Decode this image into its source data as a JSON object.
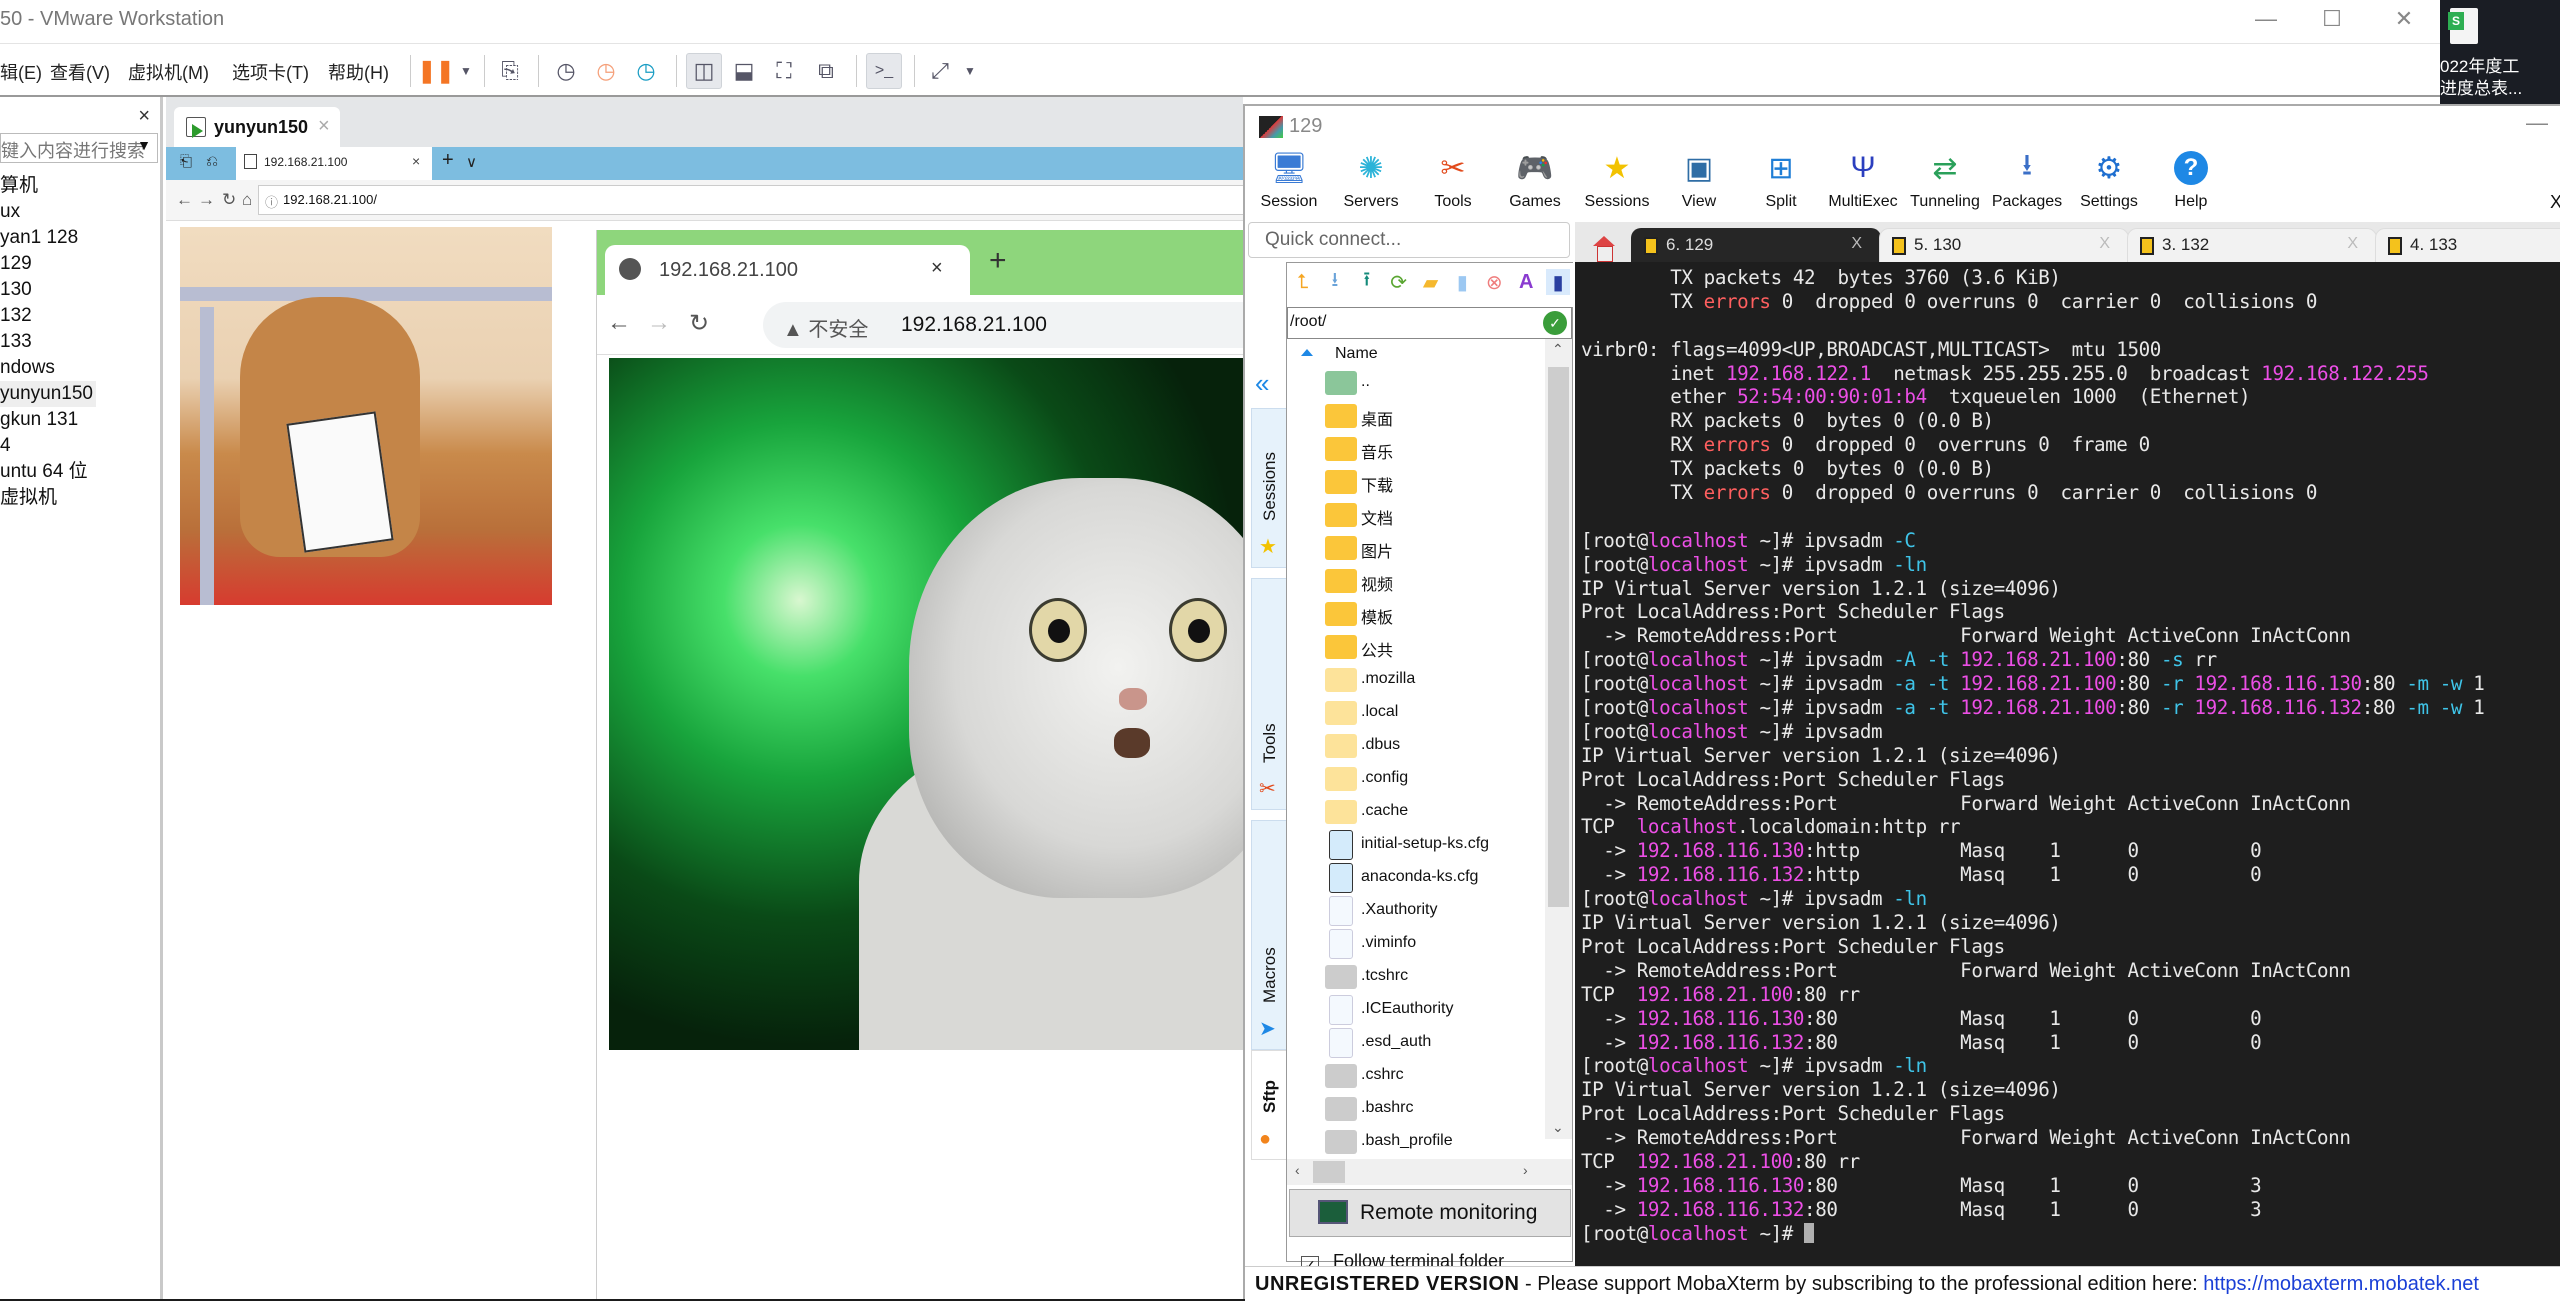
{
  "vmware": {
    "title": "50 - VMware Workstation",
    "window_controls": {
      "minimize": "—",
      "maximize": "☐",
      "close": "✕"
    },
    "menu": [
      "辑(E)",
      "查看(V)",
      "虚拟机(M)",
      "选项卡(T)",
      "帮助(H)"
    ],
    "toolbar_icons": [
      "pause-icon",
      "send-ctrl-alt-del-icon",
      "snapshot-take-icon",
      "snapshot-revert-icon",
      "snapshot-manager-icon",
      "library-view-icon",
      "thumbnail-bar-icon",
      "fullscreen-icon",
      "unity-icon",
      "console-view-icon",
      "stretch-icon"
    ],
    "library": {
      "close": "×",
      "search_placeholder": "键入内容进行搜索",
      "items": [
        "算机",
        "ux",
        "yan1 128",
        "129",
        "130",
        "132",
        "133",
        "ndows",
        "yunyun150",
        "gkun 131",
        "4",
        "untu 64 位",
        "虚拟机"
      ],
      "selected_index": 8
    },
    "vm_tab": {
      "label": "yunyun150",
      "close": "×"
    }
  },
  "guest": {
    "firefox": {
      "tab_label": "192.168.21.100",
      "tab_close": "×",
      "new_tab": "+",
      "list_tabs": "∨",
      "url": "192.168.21.100/"
    },
    "chrome": {
      "tab_label": "192.168.21.100",
      "tab_close": "×",
      "new_tab": "+",
      "insecure_label": "▲ 不安全",
      "url": "192.168.21.100"
    }
  },
  "moba": {
    "title": "129",
    "minimize": "—",
    "toolbar": [
      {
        "label": "Session",
        "icon": "session-icon"
      },
      {
        "label": "Servers",
        "icon": "servers-icon"
      },
      {
        "label": "Tools",
        "icon": "tools-icon"
      },
      {
        "label": "Games",
        "icon": "games-icon"
      },
      {
        "label": "Sessions",
        "icon": "sessions-star-icon"
      },
      {
        "label": "View",
        "icon": "view-icon"
      },
      {
        "label": "Split",
        "icon": "split-icon"
      },
      {
        "label": "MultiExec",
        "icon": "multiexec-icon"
      },
      {
        "label": "Tunneling",
        "icon": "tunneling-icon"
      },
      {
        "label": "Packages",
        "icon": "packages-icon"
      },
      {
        "label": "Settings",
        "icon": "settings-icon"
      },
      {
        "label": "Help",
        "icon": "help-icon"
      }
    ],
    "toolbar_close": "X",
    "quick_connect_placeholder": "Quick connect...",
    "session_tabs": [
      {
        "label": "6. 129",
        "active": true,
        "close": "X"
      },
      {
        "label": "5. 130",
        "active": false,
        "close": "X"
      },
      {
        "label": "3. 132",
        "active": false,
        "close": "X"
      },
      {
        "label": "4. 133",
        "active": false,
        "close": "X"
      }
    ],
    "side_tabs": [
      "Sessions",
      "Tools",
      "Macros",
      "Sftp"
    ],
    "sftp": {
      "path": "/root/",
      "column_name": "Name",
      "files": [
        {
          "name": "..",
          "type": "up"
        },
        {
          "name": "桌面",
          "type": "folder"
        },
        {
          "name": "音乐",
          "type": "folder"
        },
        {
          "name": "下载",
          "type": "folder"
        },
        {
          "name": "文档",
          "type": "folder"
        },
        {
          "name": "图片",
          "type": "folder"
        },
        {
          "name": "视频",
          "type": "folder"
        },
        {
          "name": "模板",
          "type": "folder"
        },
        {
          "name": "公共",
          "type": "folder"
        },
        {
          "name": ".mozilla",
          "type": "hfolder"
        },
        {
          "name": ".local",
          "type": "hfolder"
        },
        {
          "name": ".dbus",
          "type": "hfolder"
        },
        {
          "name": ".config",
          "type": "hfolder"
        },
        {
          "name": ".cache",
          "type": "hfolder"
        },
        {
          "name": "initial-setup-ks.cfg",
          "type": "cfg"
        },
        {
          "name": "anaconda-ks.cfg",
          "type": "cfg"
        },
        {
          "name": ".Xauthority",
          "type": "file"
        },
        {
          "name": ".viminfo",
          "type": "file"
        },
        {
          "name": ".tcshrc",
          "type": "term"
        },
        {
          "name": ".ICEauthority",
          "type": "file"
        },
        {
          "name": ".esd_auth",
          "type": "file"
        },
        {
          "name": ".cshrc",
          "type": "term"
        },
        {
          "name": ".bashrc",
          "type": "term"
        },
        {
          "name": ".bash_profile",
          "type": "term"
        }
      ],
      "remote_monitoring": "Remote monitoring",
      "follow_terminal_folder": "Follow terminal folder",
      "follow_checked": true
    },
    "terminal_lines": [
      [
        [
          "        TX packets 42  bytes 3760 (3.6 KiB)",
          ""
        ]
      ],
      [
        [
          "        TX ",
          ""
        ],
        [
          "errors",
          "r"
        ],
        [
          " 0  dropped 0 overruns 0  carrier 0  collisions 0",
          ""
        ]
      ],
      [
        [
          "",
          ""
        ]
      ],
      [
        [
          "virbr0: flags=4099<UP,BROADCAST,MULTICAST>  mtu 1500",
          ""
        ]
      ],
      [
        [
          "        inet ",
          ""
        ],
        [
          "192.168.122.1",
          "m"
        ],
        [
          "  netmask 255.255.255.0  broadcast ",
          ""
        ],
        [
          "192.168.122.255",
          "m"
        ]
      ],
      [
        [
          "        ether ",
          ""
        ],
        [
          "52:54:00:90:01:b4",
          "m"
        ],
        [
          "  txqueuelen 1000  (Ethernet)",
          ""
        ]
      ],
      [
        [
          "        RX packets 0  bytes 0 (0.0 B)",
          ""
        ]
      ],
      [
        [
          "        RX ",
          ""
        ],
        [
          "errors",
          "r"
        ],
        [
          " 0  dropped 0  overruns 0  frame 0",
          ""
        ]
      ],
      [
        [
          "        TX packets 0  bytes 0 (0.0 B)",
          ""
        ]
      ],
      [
        [
          "        TX ",
          ""
        ],
        [
          "errors",
          "r"
        ],
        [
          " 0  dropped 0 overruns 0  carrier 0  collisions 0",
          ""
        ]
      ],
      [
        [
          "",
          ""
        ]
      ],
      [
        [
          "[root@",
          ""
        ],
        [
          "localhost",
          "m"
        ],
        [
          " ~]# ipvsadm ",
          ""
        ],
        [
          "-C",
          "c"
        ]
      ],
      [
        [
          "[root@",
          ""
        ],
        [
          "localhost",
          "m"
        ],
        [
          " ~]# ipvsadm ",
          ""
        ],
        [
          "-ln",
          "c"
        ]
      ],
      [
        [
          "IP Virtual Server version 1.2.1 (size=4096)",
          ""
        ]
      ],
      [
        [
          "Prot LocalAddress:Port Scheduler Flags",
          ""
        ]
      ],
      [
        [
          "  -> RemoteAddress:Port           Forward Weight ActiveConn InActConn",
          ""
        ]
      ],
      [
        [
          "[root@",
          ""
        ],
        [
          "localhost",
          "m"
        ],
        [
          " ~]# ipvsadm ",
          ""
        ],
        [
          "-A -t",
          "c"
        ],
        [
          " ",
          ""
        ],
        [
          "192.168.21.100",
          "m"
        ],
        [
          ":80 ",
          ""
        ],
        [
          "-s",
          "c"
        ],
        [
          " rr",
          ""
        ]
      ],
      [
        [
          "[root@",
          ""
        ],
        [
          "localhost",
          "m"
        ],
        [
          " ~]# ipvsadm ",
          ""
        ],
        [
          "-a -t",
          "c"
        ],
        [
          " ",
          ""
        ],
        [
          "192.168.21.100",
          "m"
        ],
        [
          ":80 ",
          ""
        ],
        [
          "-r",
          "c"
        ],
        [
          " ",
          ""
        ],
        [
          "192.168.116.130",
          "m"
        ],
        [
          ":80 ",
          ""
        ],
        [
          "-m -w",
          "c"
        ],
        [
          " 1",
          ""
        ]
      ],
      [
        [
          "[root@",
          ""
        ],
        [
          "localhost",
          "m"
        ],
        [
          " ~]# ipvsadm ",
          ""
        ],
        [
          "-a -t",
          "c"
        ],
        [
          " ",
          ""
        ],
        [
          "192.168.21.100",
          "m"
        ],
        [
          ":80 ",
          ""
        ],
        [
          "-r",
          "c"
        ],
        [
          " ",
          ""
        ],
        [
          "192.168.116.132",
          "m"
        ],
        [
          ":80 ",
          ""
        ],
        [
          "-m -w",
          "c"
        ],
        [
          " 1",
          ""
        ]
      ],
      [
        [
          "[root@",
          ""
        ],
        [
          "localhost",
          "m"
        ],
        [
          " ~]# ipvsadm",
          ""
        ]
      ],
      [
        [
          "IP Virtual Server version 1.2.1 (size=4096)",
          ""
        ]
      ],
      [
        [
          "Prot LocalAddress:Port Scheduler Flags",
          ""
        ]
      ],
      [
        [
          "  -> RemoteAddress:Port           Forward Weight ActiveConn InActConn",
          ""
        ]
      ],
      [
        [
          "TCP  ",
          ""
        ],
        [
          "localhost",
          "m"
        ],
        [
          ".localdomain:http rr",
          ""
        ]
      ],
      [
        [
          "  -> ",
          ""
        ],
        [
          "192.168.116.130",
          "m"
        ],
        [
          ":http         Masq    1      0          0",
          ""
        ]
      ],
      [
        [
          "  -> ",
          ""
        ],
        [
          "192.168.116.132",
          "m"
        ],
        [
          ":http         Masq    1      0          0",
          ""
        ]
      ],
      [
        [
          "[root@",
          ""
        ],
        [
          "localhost",
          "m"
        ],
        [
          " ~]# ipvsadm ",
          ""
        ],
        [
          "-ln",
          "c"
        ]
      ],
      [
        [
          "IP Virtual Server version 1.2.1 (size=4096)",
          ""
        ]
      ],
      [
        [
          "Prot LocalAddress:Port Scheduler Flags",
          ""
        ]
      ],
      [
        [
          "  -> RemoteAddress:Port           Forward Weight ActiveConn InActConn",
          ""
        ]
      ],
      [
        [
          "TCP  ",
          ""
        ],
        [
          "192.168.21.100",
          "m"
        ],
        [
          ":80 rr",
          ""
        ]
      ],
      [
        [
          "  -> ",
          ""
        ],
        [
          "192.168.116.130",
          "m"
        ],
        [
          ":80           Masq    1      0          0",
          ""
        ]
      ],
      [
        [
          "  -> ",
          ""
        ],
        [
          "192.168.116.132",
          "m"
        ],
        [
          ":80           Masq    1      0          0",
          ""
        ]
      ],
      [
        [
          "[root@",
          ""
        ],
        [
          "localhost",
          "m"
        ],
        [
          " ~]# ipvsadm ",
          ""
        ],
        [
          "-ln",
          "c"
        ]
      ],
      [
        [
          "IP Virtual Server version 1.2.1 (size=4096)",
          ""
        ]
      ],
      [
        [
          "Prot LocalAddress:Port Scheduler Flags",
          ""
        ]
      ],
      [
        [
          "  -> RemoteAddress:Port           Forward Weight ActiveConn InActConn",
          ""
        ]
      ],
      [
        [
          "TCP  ",
          ""
        ],
        [
          "192.168.21.100",
          "m"
        ],
        [
          ":80 rr",
          ""
        ]
      ],
      [
        [
          "  -> ",
          ""
        ],
        [
          "192.168.116.130",
          "m"
        ],
        [
          ":80           Masq    1      0          3",
          ""
        ]
      ],
      [
        [
          "  -> ",
          ""
        ],
        [
          "192.168.116.132",
          "m"
        ],
        [
          ":80           Masq    1      0          3",
          ""
        ]
      ],
      [
        [
          "[root@",
          ""
        ],
        [
          "localhost",
          "m"
        ],
        [
          " ~]# ",
          ""
        ]
      ]
    ],
    "status": {
      "unregistered": "UNREGISTERED VERSION",
      "message": "  -  Please support MobaXterm by subscribing to the professional edition here:  ",
      "link": "https://mobaxterm.mobatek.net"
    }
  },
  "desktop_icon": {
    "label": "022年度工\n进度总表..."
  },
  "colors": {
    "term_bg": "#1e1e1e",
    "term_magenta": "#ec4fe6",
    "term_red": "#ff5f5f",
    "term_cyan": "#3fc4e8",
    "vm_tabstrip": "#7dbde0",
    "chrome_frame": "#8ed67c"
  }
}
